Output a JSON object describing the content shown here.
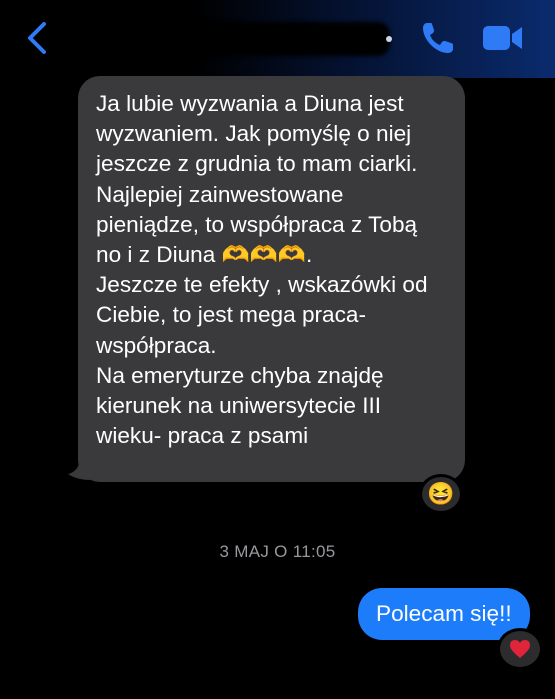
{
  "header": {
    "contact_name": "",
    "back_icon": "chevron-left-icon",
    "call_icon": "phone-icon",
    "video_icon": "video-camera-icon",
    "accent": "#2f7bf5"
  },
  "messages": [
    {
      "direction": "incoming",
      "text": "Ja lubie wyzwania a Diuna jest wyzwaniem. Jak pomyślę o niej jeszcze z grudnia to mam ciarki. Najlepiej zainwestowane pieniądze, to współpraca z Tobą no i z Diuna 🫶🫶🫶.\nJeszcze te efekty , wskazówki od Ciebie, to jest mega praca-współpraca.\nNa emeryturze chyba znajdę kierunek na uniwersytecie III wieku- praca z psami",
      "reaction": "😆",
      "bubble_color": "#3a3a3c"
    },
    {
      "direction": "outgoing",
      "text": "Polecam się!!",
      "reaction": "❤️",
      "bubble_color": "#1c7cfa"
    }
  ],
  "timestamp": "3 MAJ O 11:05"
}
